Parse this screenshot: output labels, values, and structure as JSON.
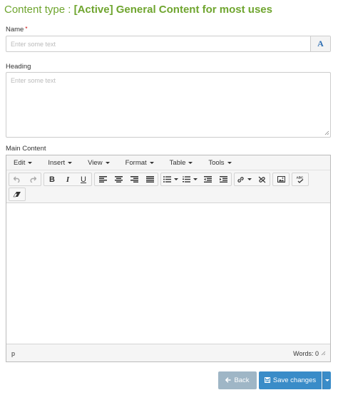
{
  "header": {
    "prefix": "Content type :",
    "content_type_name": "[Active] General Content for most uses"
  },
  "fields": {
    "name": {
      "label": "Name",
      "required_marker": "*",
      "placeholder": "Enter some text",
      "value": "",
      "addon_icon": "font-icon",
      "addon_text": "A"
    },
    "heading": {
      "label": "Heading",
      "placeholder": "Enter some text",
      "value": ""
    },
    "main_content": {
      "label": "Main Content"
    }
  },
  "editor": {
    "menus": [
      "Edit",
      "Insert",
      "View",
      "Format",
      "Table",
      "Tools"
    ],
    "toolbar_icons": [
      "undo-icon",
      "redo-icon",
      "bold-icon",
      "italic-icon",
      "underline-icon",
      "align-left-icon",
      "align-center-icon",
      "align-right-icon",
      "align-justify-icon",
      "bullet-list-icon",
      "numbered-list-icon",
      "outdent-icon",
      "indent-icon",
      "link-icon",
      "unlink-icon",
      "image-icon",
      "spellcheck-icon",
      "eraser-icon"
    ],
    "bold_label": "B",
    "italic_label": "I",
    "underline_label": "U",
    "spellcheck_label": "ABC",
    "status_path": "p",
    "word_count": "Words: 0"
  },
  "actions": {
    "back_label": "Back",
    "save_label": "Save changes"
  },
  "colors": {
    "title_green": "#6fa52f",
    "primary_blue": "#3a8cc8",
    "back_gray_blue": "#9fb6c6"
  }
}
